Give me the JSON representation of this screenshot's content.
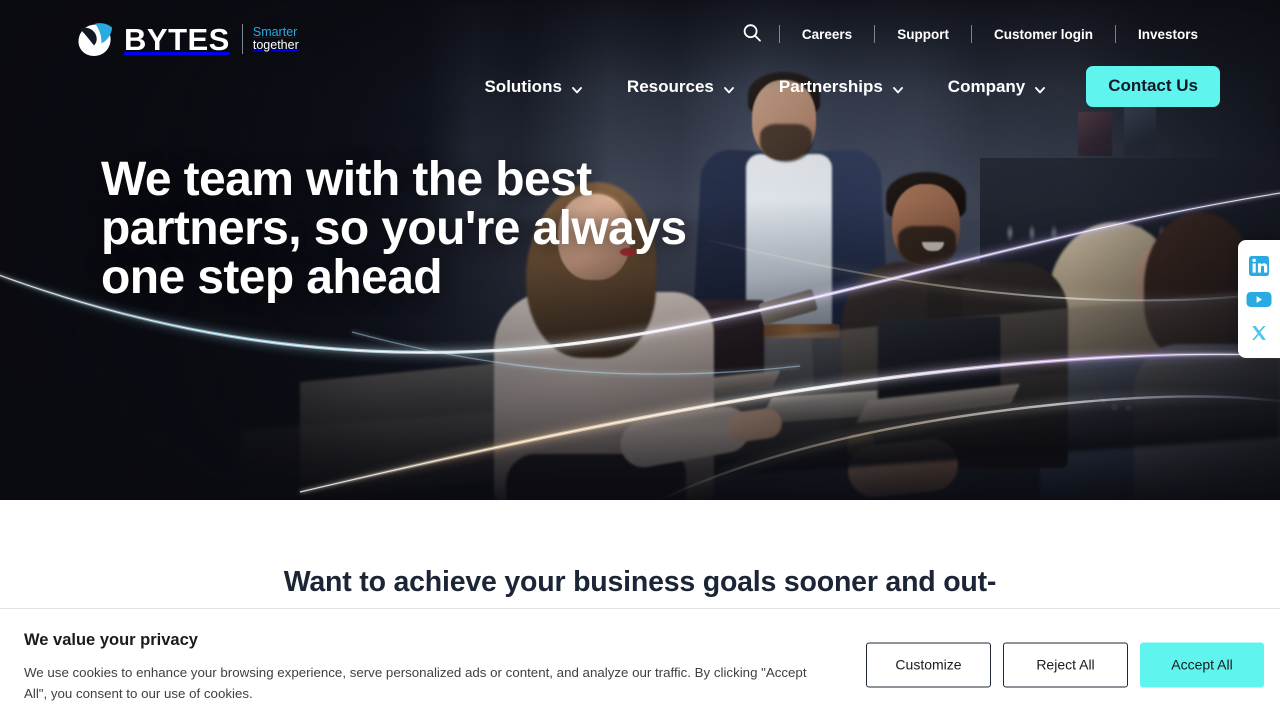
{
  "brand": {
    "name": "BYTES",
    "tagline_line1": "Smarter",
    "tagline_line2": "together",
    "accent_cyan": "#5FF5EE",
    "accent_blue": "#29ABE2",
    "dark_navy": "#131826"
  },
  "header": {
    "search_icon": "search-icon",
    "utility_links": [
      {
        "label": "Careers"
      },
      {
        "label": "Support"
      },
      {
        "label": "Customer login"
      },
      {
        "label": "Investors"
      }
    ],
    "main_nav": [
      {
        "label": "Solutions",
        "icon": "chevron-down-icon"
      },
      {
        "label": "Resources",
        "icon": "chevron-down-icon"
      },
      {
        "label": "Partnerships",
        "icon": "chevron-down-icon"
      },
      {
        "label": "Company",
        "icon": "chevron-down-icon"
      }
    ],
    "contact_button": "Contact Us"
  },
  "hero": {
    "title": "We team with the best partners, so you're always one step ahead"
  },
  "social_rail": {
    "items": [
      {
        "name": "linkedin-icon",
        "label": "LinkedIn"
      },
      {
        "name": "youtube-icon",
        "label": "YouTube"
      },
      {
        "name": "x-twitter-icon",
        "label": "X"
      }
    ]
  },
  "section": {
    "heading": "Want to achieve your business goals sooner and out-"
  },
  "cookie_banner": {
    "title": "We value your privacy",
    "body": "We use cookies to enhance your browsing experience, serve personalized ads or content, and analyze our traffic. By clicking \"Accept All\", you consent to our use of cookies.",
    "customize_label": "Customize",
    "reject_label": "Reject All",
    "accept_label": "Accept All"
  }
}
